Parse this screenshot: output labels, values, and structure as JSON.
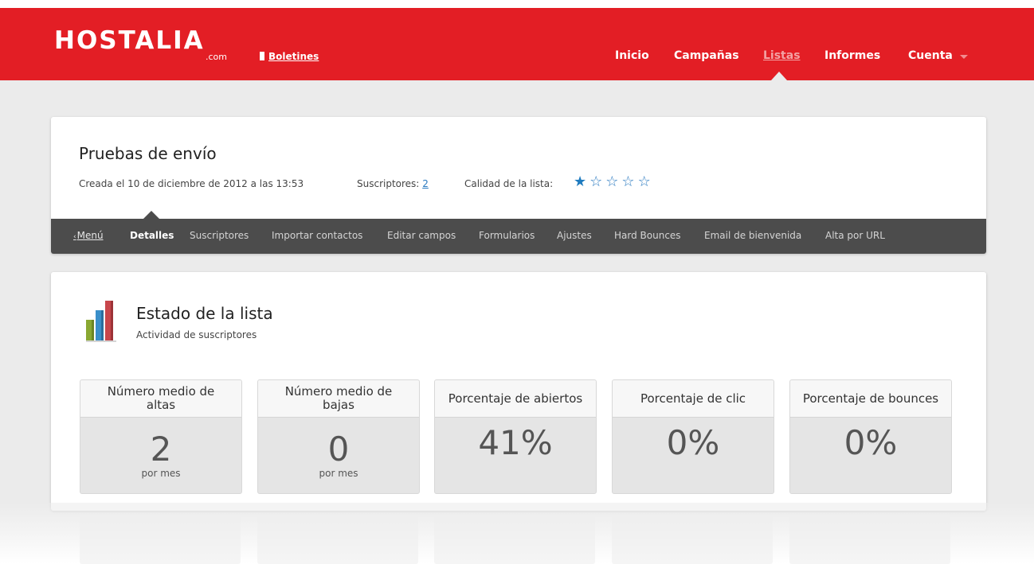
{
  "header": {
    "logo": "HOSTALIA",
    "logo_sub": ".com",
    "product_link": "Boletines",
    "nav": [
      {
        "label": "Inicio"
      },
      {
        "label": "Campañas"
      },
      {
        "label": "Listas",
        "active": true
      },
      {
        "label": "Informes"
      },
      {
        "label": "Cuenta"
      }
    ]
  },
  "list": {
    "title": "Pruebas de envío",
    "created": "Creada el 10 de diciembre de 2012 a las 13:53",
    "subscribers_label": "Suscriptores:",
    "subscribers_count": "2",
    "quality_label": "Calidad de la lista:",
    "quality_stars": 1,
    "quality_max": 5
  },
  "subnav": {
    "items": [
      {
        "label": "Menú"
      },
      {
        "label": "Detalles",
        "active": true
      },
      {
        "label": "Suscriptores"
      },
      {
        "label": "Importar contactos"
      },
      {
        "label": "Editar campos"
      },
      {
        "label": "Formularios"
      },
      {
        "label": "Ajustes"
      },
      {
        "label": "Hard Bounces"
      },
      {
        "label": "Email de bienvenida"
      },
      {
        "label": "Alta por URL"
      }
    ]
  },
  "status": {
    "title": "Estado de la lista",
    "subtitle": "Actividad de suscriptores",
    "stats": [
      {
        "label": "Número medio de altas",
        "value": "2",
        "unit": "por mes"
      },
      {
        "label": "Número medio de bajas",
        "value": "0",
        "unit": "por mes"
      },
      {
        "label": "Porcentaje de abiertos",
        "value": "41%",
        "unit": ""
      },
      {
        "label": "Porcentaje de clic",
        "value": "0%",
        "unit": ""
      },
      {
        "label": "Porcentaje de bounces",
        "value": "0%",
        "unit": ""
      }
    ]
  },
  "colors": {
    "brand_red": "#e31e25",
    "subnav_bg": "#4c4c4c",
    "link_blue": "#2a7ac0"
  }
}
